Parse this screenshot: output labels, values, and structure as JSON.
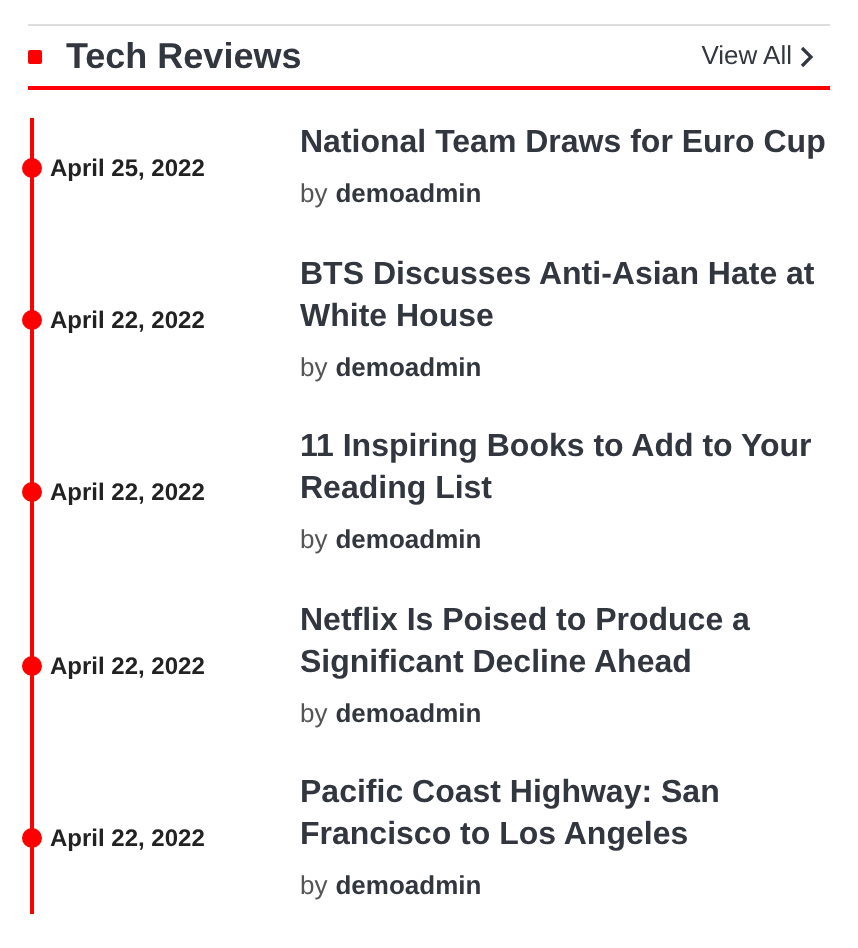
{
  "section": {
    "title": "Tech Reviews",
    "link": "View All"
  },
  "posts": [
    {
      "date": "April 25, 2022",
      "title": "National Team Draws for Euro Cup",
      "by": "by",
      "author": "demoadmin"
    },
    {
      "date": "April 22, 2022",
      "title": "BTS Discusses Anti-Asian Hate at White House",
      "by": "by",
      "author": "demoadmin"
    },
    {
      "date": "April 22, 2022",
      "title": "11 Inspiring Books to Add to Your Reading List",
      "by": "by",
      "author": "demoadmin"
    },
    {
      "date": "April 22, 2022",
      "title": "Netflix Is Poised to Produce a Significant Decline Ahead",
      "by": "by",
      "author": "demoadmin"
    },
    {
      "date": "April 22, 2022",
      "title": "Pacific Coast Highway: San Francisco to Los Angeles",
      "by": "by",
      "author": "demoadmin"
    }
  ]
}
